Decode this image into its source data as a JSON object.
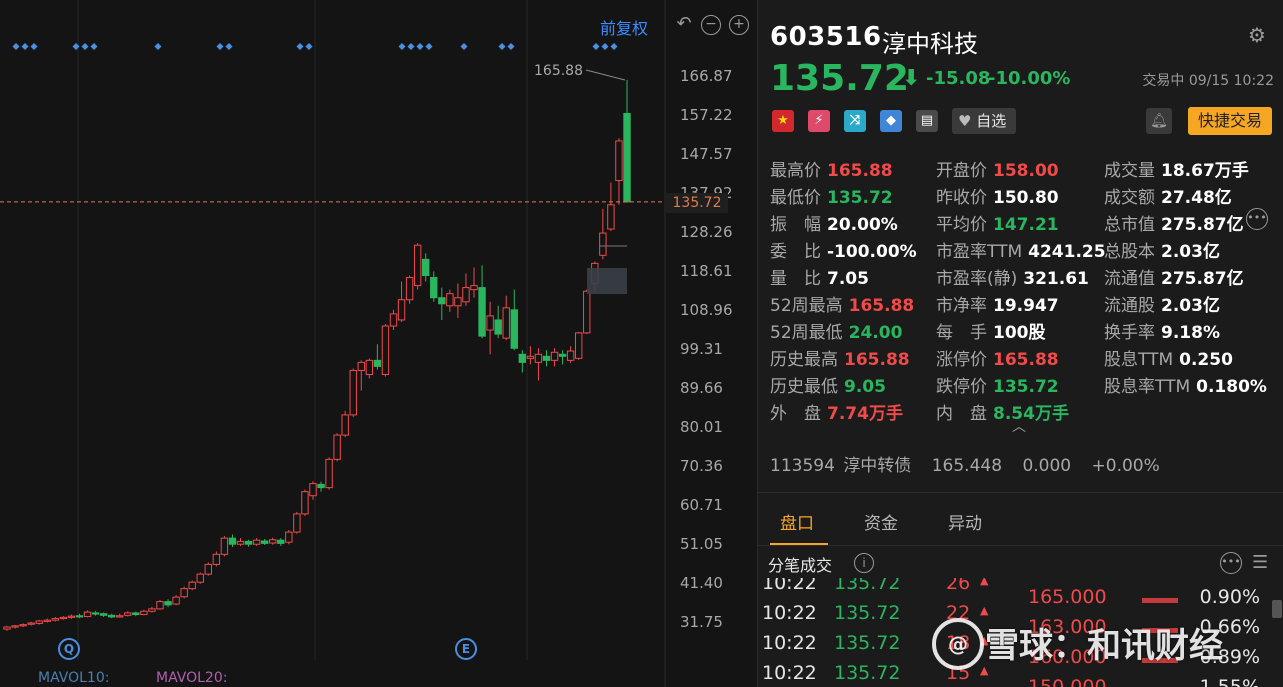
{
  "chart": {
    "adjust_label": "前复权",
    "y_ticks": [
      "166.87",
      "157.22",
      "147.57",
      "137.92",
      "128.26",
      "118.61",
      "108.96",
      "99.31",
      "89.66",
      "80.01",
      "70.36",
      "60.71",
      "51.05",
      "41.40",
      "31.75"
    ],
    "y_max": 166.87,
    "y_min": 31.75,
    "current_price_tag": "135.72",
    "high_annotation": "165.88",
    "marker_q": "Q",
    "marker_e": "E",
    "ma_labels": {
      "mavol10": "MAVOL10:",
      "mavol20": "MAVOL20:"
    },
    "colors": {
      "up": "#f04a4a",
      "down": "#2ab55f",
      "marker": "#4a8fe0",
      "price_line": "#e07b4f"
    }
  },
  "chart_data": {
    "type": "candlestick",
    "y_range": [
      31.75,
      166.87
    ],
    "candles": [
      [
        30,
        30.5,
        29.6,
        30.8
      ],
      [
        30.5,
        30.8,
        30.1,
        31.0
      ],
      [
        30.9,
        31.1,
        30.5,
        31.4
      ],
      [
        31.2,
        31.5,
        30.9,
        31.8
      ],
      [
        31.4,
        32.0,
        31.1,
        32.3
      ],
      [
        31.9,
        32.2,
        31.6,
        32.6
      ],
      [
        32.2,
        32.6,
        31.9,
        33.0
      ],
      [
        32.6,
        32.9,
        32.3,
        33.2
      ],
      [
        32.9,
        33.2,
        32.5,
        33.6
      ],
      [
        33.3,
        33.0,
        32.7,
        33.8
      ],
      [
        33.1,
        34.2,
        32.9,
        34.6
      ],
      [
        34.0,
        33.8,
        33.3,
        34.5
      ],
      [
        33.8,
        33.4,
        33.0,
        34.1
      ],
      [
        33.4,
        33.0,
        32.7,
        33.8
      ],
      [
        33.0,
        33.3,
        32.8,
        33.8
      ],
      [
        33.4,
        34.0,
        33.1,
        34.4
      ],
      [
        34.0,
        33.6,
        33.2,
        34.3
      ],
      [
        33.6,
        34.4,
        33.4,
        34.8
      ],
      [
        34.4,
        35.0,
        34.1,
        35.5
      ],
      [
        35.0,
        36.8,
        34.8,
        37.2
      ],
      [
        36.8,
        36.0,
        35.4,
        37.4
      ],
      [
        36.2,
        37.9,
        35.9,
        38.4
      ],
      [
        38.0,
        40.0,
        37.6,
        40.5
      ],
      [
        40.0,
        41.6,
        39.6,
        42.0
      ],
      [
        41.6,
        43.6,
        41.2,
        44.0
      ],
      [
        43.6,
        46.0,
        43.2,
        46.5
      ],
      [
        46.0,
        48.5,
        45.5,
        49.2
      ],
      [
        48.5,
        52.5,
        48.0,
        53.0
      ],
      [
        52.5,
        51.0,
        50.3,
        53.4
      ],
      [
        51.0,
        51.7,
        50.6,
        52.5
      ],
      [
        51.7,
        51.0,
        50.4,
        52.1
      ],
      [
        51.0,
        52.0,
        50.6,
        52.5
      ],
      [
        51.8,
        51.2,
        50.8,
        52.3
      ],
      [
        51.3,
        52.1,
        50.9,
        52.6
      ],
      [
        52.0,
        51.2,
        50.6,
        52.5
      ],
      [
        51.5,
        54.0,
        51.0,
        54.5
      ],
      [
        54.0,
        58.5,
        53.6,
        59.0
      ],
      [
        58.5,
        64.0,
        58.0,
        64.5
      ],
      [
        63.0,
        66.0,
        62.0,
        66.6
      ],
      [
        65.8,
        65.0,
        64.0,
        66.5
      ],
      [
        65.0,
        72.0,
        64.5,
        72.5
      ],
      [
        72.0,
        78.0,
        71.5,
        78.5
      ],
      [
        78.0,
        83.0,
        77.5,
        84.0
      ],
      [
        83.0,
        94.0,
        82.5,
        94.5
      ],
      [
        94.0,
        96.0,
        89.0,
        96.5
      ],
      [
        93.0,
        96.5,
        92.0,
        97.0
      ],
      [
        96.5,
        95.0,
        94.2,
        100.5
      ],
      [
        93.0,
        105.0,
        92.5,
        105.5
      ],
      [
        105.0,
        108.0,
        104.0,
        109.0
      ],
      [
        106.5,
        111.5,
        106.0,
        116.0
      ],
      [
        111.5,
        117.0,
        110.5,
        117.5
      ],
      [
        115.0,
        125.0,
        114.0,
        125.5
      ],
      [
        121.5,
        117.5,
        116.0,
        123.0
      ],
      [
        117.0,
        112.0,
        111.0,
        118.5
      ],
      [
        112.0,
        110.5,
        106.5,
        114.5
      ],
      [
        110.0,
        113.0,
        108.5,
        114.0
      ],
      [
        110.0,
        112.0,
        107.0,
        115.5
      ],
      [
        111.0,
        114.5,
        110.0,
        118.0
      ],
      [
        114.0,
        115.0,
        112.0,
        119.5
      ],
      [
        114.5,
        102.5,
        102.0,
        120.0
      ],
      [
        104.0,
        107.5,
        98.0,
        111.0
      ],
      [
        106.5,
        103.0,
        102.0,
        110.0
      ],
      [
        102.0,
        109.5,
        101.5,
        112.5
      ],
      [
        109.0,
        99.5,
        99.0,
        114.0
      ],
      [
        98.0,
        96.0,
        93.5,
        99.0
      ],
      [
        97.0,
        97.5,
        95.5,
        100.0
      ],
      [
        96.0,
        98.0,
        91.5,
        99.5
      ],
      [
        97.5,
        96.5,
        95.0,
        99.0
      ],
      [
        96.5,
        98.5,
        95.0,
        99.5
      ],
      [
        98.0,
        97.5,
        95.5,
        99.0
      ],
      [
        96.5,
        98.8,
        95.8,
        100.0
      ],
      [
        97.0,
        103.3,
        96.6,
        103.5
      ],
      [
        103.3,
        113.6,
        103.0,
        114.0
      ],
      [
        115.5,
        120.5,
        113.5,
        121.0
      ],
      [
        122.5,
        128.0,
        121.5,
        134.0
      ],
      [
        129.0,
        135.0,
        128.5,
        140.5
      ],
      [
        141.0,
        150.8,
        135.0,
        151.5
      ],
      [
        157.6,
        135.72,
        135.72,
        165.88
      ]
    ],
    "signals_row": "◆◆◆ ◆◆◆ ◆ ◆◆ ◆◆ ◆◆◆◆ ◆ ◆◆ ◆◆◆"
  },
  "quote": {
    "code": "603516",
    "name": "淳中科技",
    "price": "135.72",
    "change": "-15.08",
    "change_pct": "-10.00%",
    "status": "交易中 09/15 10:22",
    "watch_label": "自选",
    "quick_trade_label": "快捷交易",
    "stats": [
      {
        "label": "最高价",
        "value": "165.88",
        "color": "red"
      },
      {
        "label": "最低价",
        "value": "135.72",
        "color": "green"
      },
      {
        "label": "振　幅",
        "value": "20.00%",
        "color": "white"
      },
      {
        "label": "委　比",
        "value": "-100.00%",
        "color": "white"
      },
      {
        "label": "量　比",
        "value": "7.05",
        "color": "white"
      },
      {
        "label": "52周最高",
        "value": "165.88",
        "color": "red"
      },
      {
        "label": "52周最低",
        "value": "24.00",
        "color": "green"
      },
      {
        "label": "历史最高",
        "value": "165.88",
        "color": "red"
      },
      {
        "label": "历史最低",
        "value": "9.05",
        "color": "green"
      },
      {
        "label": "外　盘",
        "value": "7.74万手",
        "color": "red"
      },
      {
        "label": "开盘价",
        "value": "158.00",
        "color": "red"
      },
      {
        "label": "昨收价",
        "value": "150.80",
        "color": "white"
      },
      {
        "label": "平均价",
        "value": "147.21",
        "color": "green"
      },
      {
        "label": "市盈率TTM",
        "value": "4241.25",
        "color": "white"
      },
      {
        "label": "市盈率(静)",
        "value": "321.61",
        "color": "white"
      },
      {
        "label": "市净率",
        "value": "19.947",
        "color": "white"
      },
      {
        "label": "每　手",
        "value": "100股",
        "color": "white"
      },
      {
        "label": "涨停价",
        "value": "165.88",
        "color": "red"
      },
      {
        "label": "跌停价",
        "value": "135.72",
        "color": "green"
      },
      {
        "label": "内　盘",
        "value": "8.54万手",
        "color": "green"
      },
      {
        "label": "成交量",
        "value": "18.67万手",
        "color": "white"
      },
      {
        "label": "成交额",
        "value": "27.48亿",
        "color": "white"
      },
      {
        "label": "总市值",
        "value": "275.87亿",
        "color": "white"
      },
      {
        "label": "总股本",
        "value": "2.03亿",
        "color": "white"
      },
      {
        "label": "流通值",
        "value": "275.87亿",
        "color": "white"
      },
      {
        "label": "流通股",
        "value": "2.03亿",
        "color": "white"
      },
      {
        "label": "换手率",
        "value": "9.18%",
        "color": "white"
      },
      {
        "label": "股息TTM",
        "value": "0.250",
        "color": "white"
      },
      {
        "label": "股息率TTM",
        "value": "0.180%",
        "color": "white"
      }
    ],
    "bond": {
      "code": "113594",
      "name": "淳中转债",
      "price": "165.448",
      "change": "0.000",
      "pct": "+0.00%"
    }
  },
  "tabs": [
    "盘口",
    "资金",
    "异动"
  ],
  "ticks": {
    "title": "分笔成交",
    "rows": [
      {
        "time": "10:22",
        "price": "135.72",
        "vol": "26"
      },
      {
        "time": "10:22",
        "price": "135.72",
        "vol": "22"
      },
      {
        "time": "10:22",
        "price": "135.72",
        "vol": "18"
      },
      {
        "time": "10:22",
        "price": "135.72",
        "vol": "15"
      }
    ],
    "depth": [
      {
        "price": "165.000",
        "pct": "0.90%"
      },
      {
        "price": "163.000",
        "pct": "0.66%"
      },
      {
        "price": "160.000",
        "pct": "0.89%"
      },
      {
        "price": "150.000",
        "pct": "1.55%"
      }
    ]
  },
  "watermark": "雪球：和讯财经",
  "icons": {
    "gear": "gear-icon",
    "undo": "undo-icon",
    "zoom_out": "zoom-out-icon",
    "zoom_in": "zoom-in-icon",
    "bell": "bell-icon",
    "heart": "heart-icon",
    "info": "info-icon",
    "more": "more-icon",
    "menu": "menu-icon"
  }
}
